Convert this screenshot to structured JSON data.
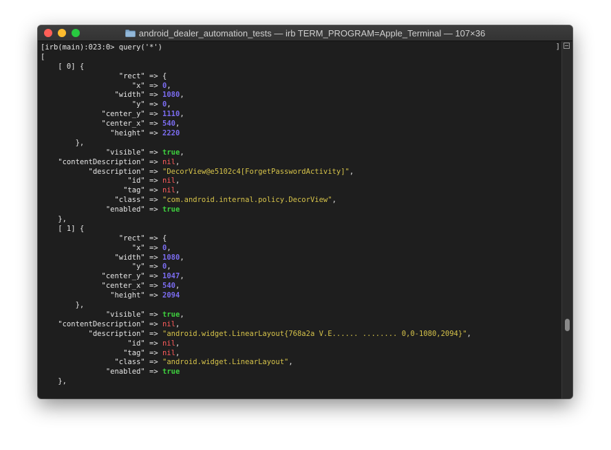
{
  "window": {
    "title": "android_dealer_automation_tests — irb TERM_PROGRAM=Apple_Terminal — 107×36",
    "close_glyph": "✕",
    "minimize_glyph": "–",
    "zoom_glyph": "+",
    "title_icon": "folder-icon"
  },
  "colors": {
    "number": "#7b6cf0",
    "true": "#3ecf3e",
    "nil": "#ff5c5c",
    "string": "#d6c34a"
  },
  "terminal": {
    "right_marker": "]",
    "lines": [
      [
        {
          "t": "k",
          "v": "[irb(main):023:0> query('*')"
        }
      ],
      [
        {
          "t": "k",
          "v": "["
        }
      ],
      [
        {
          "t": "k",
          "v": "    [ 0] {"
        }
      ],
      [
        {
          "t": "k",
          "v": "                  \"rect\" => {"
        }
      ],
      [
        {
          "t": "k",
          "v": "                     \"x\" => "
        },
        {
          "t": "num",
          "v": "0"
        },
        {
          "t": "k",
          "v": ","
        }
      ],
      [
        {
          "t": "k",
          "v": "                 \"width\" => "
        },
        {
          "t": "num",
          "v": "1080"
        },
        {
          "t": "k",
          "v": ","
        }
      ],
      [
        {
          "t": "k",
          "v": "                     \"y\" => "
        },
        {
          "t": "num",
          "v": "0"
        },
        {
          "t": "k",
          "v": ","
        }
      ],
      [
        {
          "t": "k",
          "v": "              \"center_y\" => "
        },
        {
          "t": "num",
          "v": "1110"
        },
        {
          "t": "k",
          "v": ","
        }
      ],
      [
        {
          "t": "k",
          "v": "              \"center_x\" => "
        },
        {
          "t": "num",
          "v": "540"
        },
        {
          "t": "k",
          "v": ","
        }
      ],
      [
        {
          "t": "k",
          "v": "                \"height\" => "
        },
        {
          "t": "num",
          "v": "2220"
        }
      ],
      [
        {
          "t": "k",
          "v": "        },"
        }
      ],
      [
        {
          "t": "k",
          "v": "               \"visible\" => "
        },
        {
          "t": "tru",
          "v": "true"
        },
        {
          "t": "k",
          "v": ","
        }
      ],
      [
        {
          "t": "k",
          "v": "    \"contentDescription\" => "
        },
        {
          "t": "nil",
          "v": "nil"
        },
        {
          "t": "k",
          "v": ","
        }
      ],
      [
        {
          "t": "k",
          "v": "           \"description\" => "
        },
        {
          "t": "str",
          "v": "\"DecorView@e5102c4[ForgetPasswordActivity]\""
        },
        {
          "t": "k",
          "v": ","
        }
      ],
      [
        {
          "t": "k",
          "v": "                    \"id\" => "
        },
        {
          "t": "nil",
          "v": "nil"
        },
        {
          "t": "k",
          "v": ","
        }
      ],
      [
        {
          "t": "k",
          "v": "                   \"tag\" => "
        },
        {
          "t": "nil",
          "v": "nil"
        },
        {
          "t": "k",
          "v": ","
        }
      ],
      [
        {
          "t": "k",
          "v": "                 \"class\" => "
        },
        {
          "t": "str",
          "v": "\"com.android.internal.policy.DecorView\""
        },
        {
          "t": "k",
          "v": ","
        }
      ],
      [
        {
          "t": "k",
          "v": "               \"enabled\" => "
        },
        {
          "t": "tru",
          "v": "true"
        }
      ],
      [
        {
          "t": "k",
          "v": "    },"
        }
      ],
      [
        {
          "t": "k",
          "v": "    [ 1] {"
        }
      ],
      [
        {
          "t": "k",
          "v": "                  \"rect\" => {"
        }
      ],
      [
        {
          "t": "k",
          "v": "                     \"x\" => "
        },
        {
          "t": "num",
          "v": "0"
        },
        {
          "t": "k",
          "v": ","
        }
      ],
      [
        {
          "t": "k",
          "v": "                 \"width\" => "
        },
        {
          "t": "num",
          "v": "1080"
        },
        {
          "t": "k",
          "v": ","
        }
      ],
      [
        {
          "t": "k",
          "v": "                     \"y\" => "
        },
        {
          "t": "num",
          "v": "0"
        },
        {
          "t": "k",
          "v": ","
        }
      ],
      [
        {
          "t": "k",
          "v": "              \"center_y\" => "
        },
        {
          "t": "num",
          "v": "1047"
        },
        {
          "t": "k",
          "v": ","
        }
      ],
      [
        {
          "t": "k",
          "v": "              \"center_x\" => "
        },
        {
          "t": "num",
          "v": "540"
        },
        {
          "t": "k",
          "v": ","
        }
      ],
      [
        {
          "t": "k",
          "v": "                \"height\" => "
        },
        {
          "t": "num",
          "v": "2094"
        }
      ],
      [
        {
          "t": "k",
          "v": "        },"
        }
      ],
      [
        {
          "t": "k",
          "v": "               \"visible\" => "
        },
        {
          "t": "tru",
          "v": "true"
        },
        {
          "t": "k",
          "v": ","
        }
      ],
      [
        {
          "t": "k",
          "v": "    \"contentDescription\" => "
        },
        {
          "t": "nil",
          "v": "nil"
        },
        {
          "t": "k",
          "v": ","
        }
      ],
      [
        {
          "t": "k",
          "v": "           \"description\" => "
        },
        {
          "t": "str",
          "v": "\"android.widget.LinearLayout{768a2a V.E...... ........ 0,0-1080,2094}\""
        },
        {
          "t": "k",
          "v": ","
        }
      ],
      [
        {
          "t": "k",
          "v": "                    \"id\" => "
        },
        {
          "t": "nil",
          "v": "nil"
        },
        {
          "t": "k",
          "v": ","
        }
      ],
      [
        {
          "t": "k",
          "v": "                   \"tag\" => "
        },
        {
          "t": "nil",
          "v": "nil"
        },
        {
          "t": "k",
          "v": ","
        }
      ],
      [
        {
          "t": "k",
          "v": "                 \"class\" => "
        },
        {
          "t": "str",
          "v": "\"android.widget.LinearLayout\""
        },
        {
          "t": "k",
          "v": ","
        }
      ],
      [
        {
          "t": "k",
          "v": "               \"enabled\" => "
        },
        {
          "t": "tru",
          "v": "true"
        }
      ],
      [
        {
          "t": "k",
          "v": "    },"
        }
      ]
    ]
  }
}
